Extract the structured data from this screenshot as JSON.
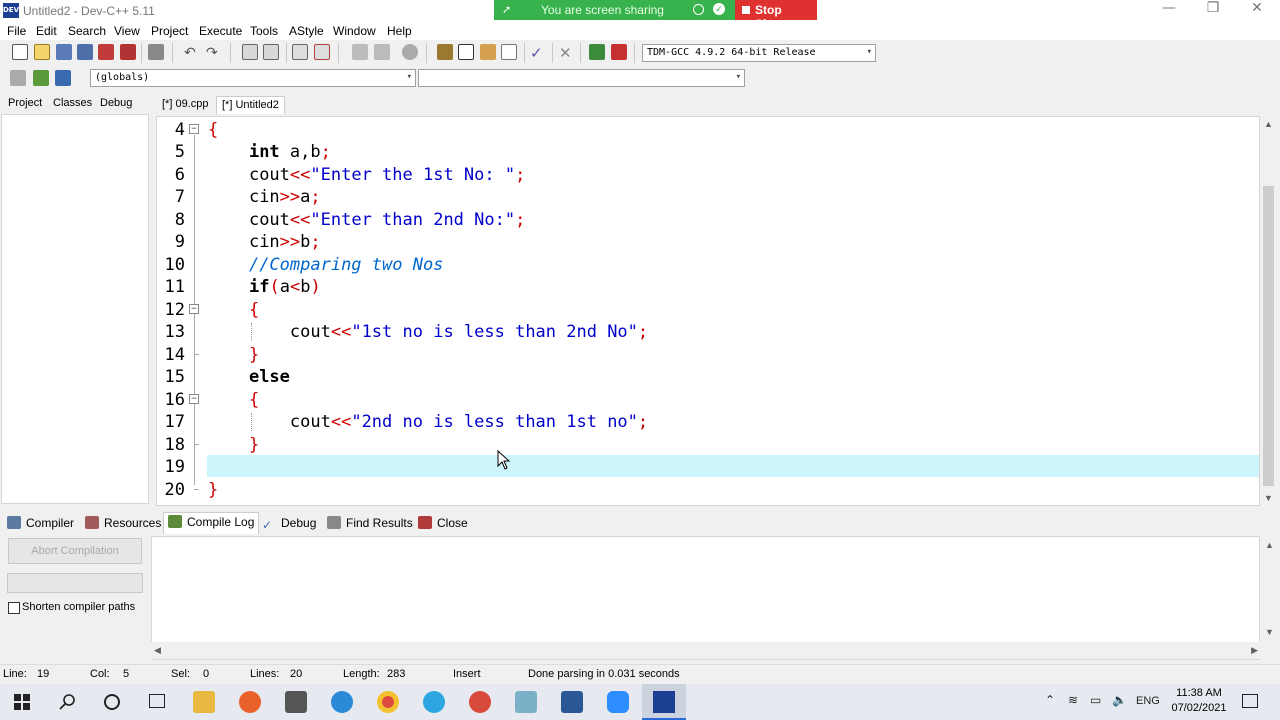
{
  "window": {
    "title": "Untitled2 - Dev-C++ 5.11",
    "app_icon_label": "DEV",
    "buttons": {
      "minimize": "—",
      "restore": "❐",
      "close": "✕"
    }
  },
  "screen_share": {
    "status_text": "You are screen sharing",
    "stop_label": "Stop Share"
  },
  "menu": [
    "File",
    "Edit",
    "Search",
    "View",
    "Project",
    "Execute",
    "Tools",
    "AStyle",
    "Window",
    "Help"
  ],
  "toolbar": {
    "compiler_select": "TDM-GCC 4.9.2 64-bit Release",
    "scope_select": "(globals)",
    "member_select": ""
  },
  "left_tabs": [
    "Project",
    "Classes",
    "Debug"
  ],
  "editor_tabs": [
    "[*] 09.cpp",
    "[*] Untitled2"
  ],
  "editor": {
    "line_numbers": [
      "4",
      "5",
      "6",
      "7",
      "8",
      "9",
      "10",
      "11",
      "12",
      "13",
      "14",
      "15",
      "16",
      "17",
      "18",
      "19",
      "20"
    ],
    "lines": {
      "l4": {
        "brace": "{"
      },
      "l5": {
        "kw": "int",
        "rest": " a,b",
        "semi": ";"
      },
      "l6": {
        "id": "cout",
        "op": "<<",
        "str": "\"Enter the 1st No: \"",
        "semi": ";"
      },
      "l7": {
        "id": "cin",
        "op": ">>",
        "rest": "a",
        "semi": ";"
      },
      "l8": {
        "id": "cout",
        "op": "<<",
        "str": "\"Enter than 2nd No:\"",
        "semi": ";"
      },
      "l9": {
        "id": "cin",
        "op": ">>",
        "rest": "b",
        "semi": ";"
      },
      "l10": {
        "comment": "//Comparing two Nos"
      },
      "l11": {
        "kw": "if",
        "p1": "(",
        "a": "a",
        "lt": "<",
        "b": "b",
        "p2": ")"
      },
      "l12": {
        "brace": "{"
      },
      "l13": {
        "id": "cout",
        "op": "<<",
        "str": "\"1st no is less than 2nd No\"",
        "semi": ";"
      },
      "l14": {
        "brace": "}"
      },
      "l15": {
        "kw": "else"
      },
      "l16": {
        "brace": "{"
      },
      "l17": {
        "id": "cout",
        "op": "<<",
        "str": "\"2nd no is less than 1st no\"",
        "semi": ";"
      },
      "l18": {
        "brace": "}"
      },
      "l20": {
        "brace": "}"
      }
    }
  },
  "bottom_tabs": [
    "Compiler",
    "Resources",
    "Compile Log",
    "Debug",
    "Find Results",
    "Close"
  ],
  "compile_panel": {
    "abort_label": "Abort Compilation",
    "shorten_label": "Shorten compiler paths"
  },
  "status": {
    "line_label": "Line:",
    "line": "19",
    "col_label": "Col:",
    "col": "5",
    "sel_label": "Sel:",
    "sel": "0",
    "lines_label": "Lines:",
    "lines": "20",
    "length_label": "Length:",
    "length": "283",
    "mode": "Insert",
    "message": "Done parsing in 0.031 seconds"
  },
  "taskbar": {
    "language": "ENG",
    "time": "11:38 AM",
    "date": "07/02/2021"
  },
  "colors": {
    "share_green": "#37b24d",
    "stop_red": "#e03131",
    "current_line": "#ccf5fc",
    "string_blue": "#0000cc",
    "operator_red": "#cc0000"
  }
}
